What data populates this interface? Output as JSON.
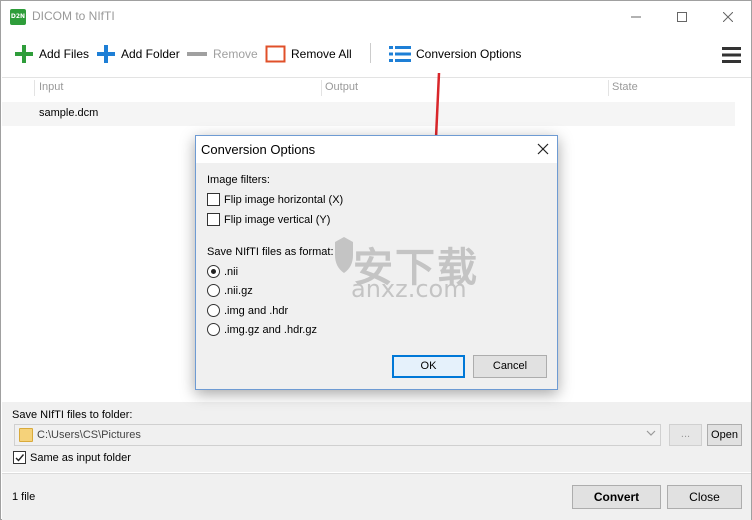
{
  "window": {
    "title": "DICOM to NIfTI",
    "app_icon_text": "D2N"
  },
  "toolbar": {
    "add_files": "Add Files",
    "add_folder": "Add Folder",
    "remove": "Remove",
    "remove_all": "Remove All",
    "conversion_options": "Conversion Options"
  },
  "list": {
    "columns": [
      "Input",
      "Output",
      "State"
    ],
    "rows": [
      {
        "input": "sample.dcm",
        "output": "",
        "state": ""
      }
    ]
  },
  "output": {
    "label": "Save NIfTI files to folder:",
    "path": "C:\\Users\\CS\\Pictures",
    "browse_label": "...",
    "open_label": "Open",
    "same_as_input_label": "Same as input folder",
    "same_as_input_checked": true
  },
  "status": {
    "file_count": "1 file",
    "convert_label": "Convert",
    "close_label": "Close"
  },
  "dialog": {
    "title": "Conversion Options",
    "image_filters_label": "Image filters:",
    "flip_horizontal": "Flip image horizontal (X)",
    "flip_vertical": "Flip image vertical (Y)",
    "format_label": "Save NIfTI files as format:",
    "formats": [
      ".nii",
      ".nii.gz",
      ".img and .hdr",
      ".img.gz and .hdr.gz"
    ],
    "selected_format": ".nii",
    "ok_label": "OK",
    "cancel_label": "Cancel"
  },
  "watermark": {
    "cn": "安下载",
    "en": "anxz.com"
  },
  "colors": {
    "add_green": "#2e9d3a",
    "add_blue": "#1e7fd6",
    "remove_all_red": "#e0502a",
    "options_blue": "#1e7fd6",
    "annotation_red": "#d9262a",
    "dialog_border": "#6e9bd3",
    "ok_border": "#0078d7"
  }
}
